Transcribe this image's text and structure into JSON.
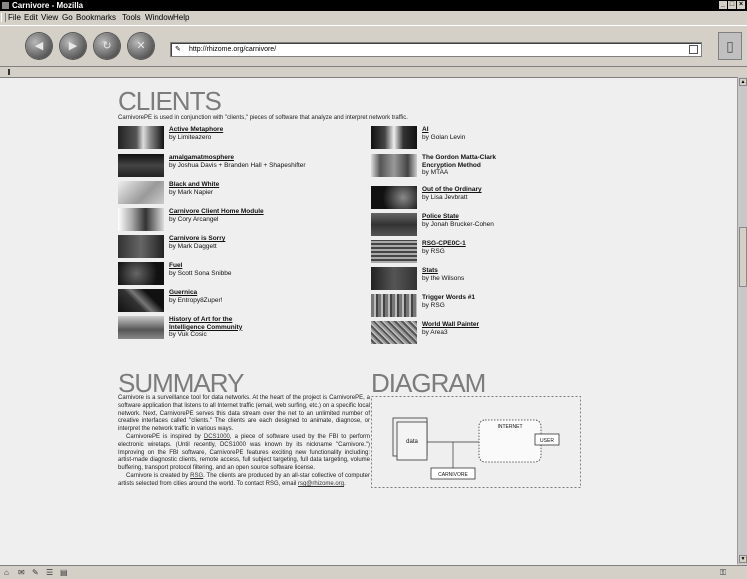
{
  "window": {
    "title": "Carnivore - Mozilla"
  },
  "menu": [
    "File",
    "Edit",
    "View",
    "Go",
    "Bookmarks",
    "Tools",
    "Window",
    "Help"
  ],
  "nav": {
    "url": "http://rhizome.org/carnivore/"
  },
  "clients": {
    "heading": "CLIENTS",
    "intro": "CarnivorePE is used in conjunction with \"clients,\" pieces of software that analyze and interpret network traffic.",
    "left": [
      {
        "title": "Active Metaphore",
        "by": "by Limiteazero"
      },
      {
        "title": "amalgamatmosphere",
        "by": "by Joshua Davis + Branden Hall + Shapeshifter"
      },
      {
        "title": "Black and White",
        "by": "by Mark Napier"
      },
      {
        "title": "Carnivore Client Home Module",
        "by": "by Cory Arcangel"
      },
      {
        "title": "Carnivore is Sorry",
        "by": "by Mark Daggett"
      },
      {
        "title": "Fuel",
        "by": "by Scott Sona Snibbe"
      },
      {
        "title": "Guernica",
        "by": "by Entropy8Zuper!"
      },
      {
        "title": "History of Art for the",
        "title2": "Intelligence Community",
        "by": "by Vuk Cosic"
      }
    ],
    "right": [
      {
        "title": "AI",
        "by": "by Golan Levin"
      },
      {
        "title": "The Gordon Matta-Clark",
        "title2": "Encryption Method",
        "by": "by MTAA"
      },
      {
        "title": "Out of the Ordinary",
        "by": "by Lisa Jevbratt"
      },
      {
        "title": "Police State",
        "by": "by Jonah Brucker-Cohen"
      },
      {
        "title": "RSG-CPE0C-1",
        "by": "by RSG"
      },
      {
        "title": "Stats",
        "by": "by the Wilsons"
      },
      {
        "title": "Trigger Words #1",
        "by": "by RSG"
      },
      {
        "title": "World Wall Painter",
        "by": "by Area3"
      }
    ]
  },
  "summary": {
    "heading": "SUMMARY",
    "p1": "Carnivore is a surveillance tool for data networks. At the heart of the project is CarnivorePE, a software application that listens to all Internet traffic (email, web surfing, etc.) on a specific local network. Next, CarnivorePE serves this data stream over the net to an unlimited number of creative interfaces called \"clients.\" The clients are each designed to animate, diagnose, or interpret the network traffic in various ways.",
    "p2a": "CarnivorePE is inspired by ",
    "p2link": "DCS1000",
    "p2b": ", a piece of software used by the FBI to perform electronic wiretaps. (Until recently, DCS1000 was known by its nickname \"Carnivore.\") Improving on the FBI software, CarnivorePE features exciting new functionality including: artist-made diagnostic clients, remote access, full subject targeting, full data targeting, volume buffering, transport protocol filtering, and an open source software license.",
    "p3a": "Carnivore is created by ",
    "p3link": "RSG",
    "p3b": ". The clients are produced by an all-star collective of computer artists selected from cities around the world. To contact RSG, email ",
    "p3email": "rsg@rhizome.org",
    "p3c": "."
  },
  "diagram": {
    "heading": "DIAGRAM",
    "data": "data",
    "internet": "INTERNET",
    "user": "USER",
    "carnivore": "CARNIVORE"
  }
}
